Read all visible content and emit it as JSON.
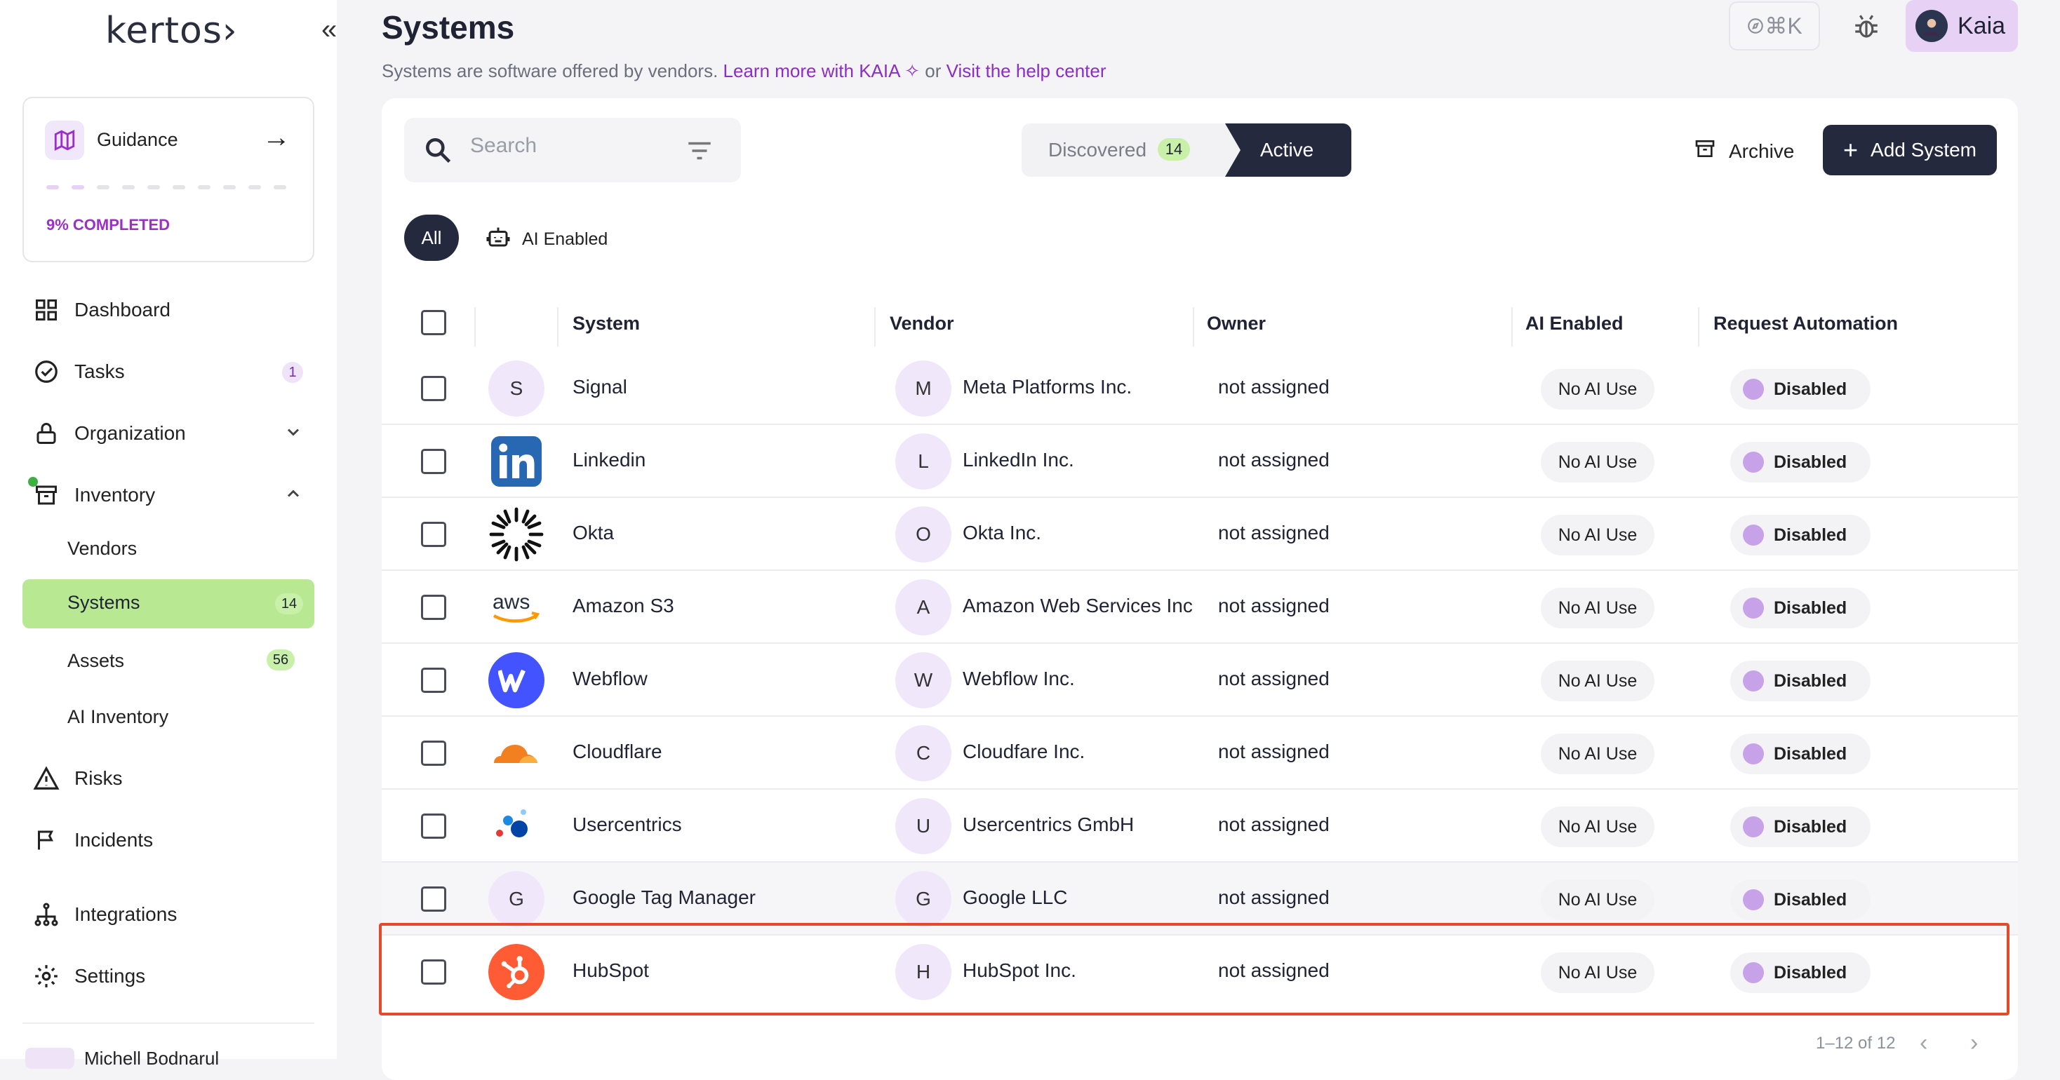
{
  "sidebar": {
    "logo": "kertos›",
    "collapse_icon": "«",
    "guidance": {
      "label": "Guidance",
      "progress_text": "9% COMPLETED",
      "progress": 0.09
    },
    "nav": {
      "dashboard": "Dashboard",
      "tasks": "Tasks",
      "tasks_count": "1",
      "organization": "Organization",
      "inventory": "Inventory",
      "vendors": "Vendors",
      "systems": "Systems",
      "systems_count": "14",
      "assets": "Assets",
      "assets_count": "56",
      "ai_inventory": "AI Inventory",
      "risks": "Risks",
      "incidents": "Incidents",
      "integrations": "Integrations",
      "settings": "Settings"
    },
    "user_bottom": "Michell Bodnarul"
  },
  "header": {
    "title": "Systems",
    "subtitle_prefix": "Systems are software offered by vendors.",
    "link_kaia": "Learn more with KAIA",
    "subtitle_or": "or",
    "link_help": "Visit the help center",
    "shortcut": "⌘K",
    "user_name": "Kaia"
  },
  "toolbar": {
    "search_placeholder": "Search",
    "tab_discovered": "Discovered",
    "tab_discovered_count": "14",
    "tab_active": "Active",
    "archive": "Archive",
    "add_system": "Add System",
    "filter_all": "All",
    "filter_ai": "AI Enabled"
  },
  "table": {
    "columns": {
      "system": "System",
      "vendor": "Vendor",
      "owner": "Owner",
      "ai": "AI Enabled",
      "request": "Request Automation"
    },
    "rows": [
      {
        "system": "Signal",
        "logo": "S",
        "vendor_initial": "M",
        "vendor": "Meta Platforms Inc.",
        "owner": "not assigned",
        "ai": "No AI Use",
        "request": "Disabled"
      },
      {
        "system": "Linkedin",
        "logo": "linkedin-logo",
        "vendor_initial": "L",
        "vendor": "LinkedIn Inc.",
        "owner": "not assigned",
        "ai": "No AI Use",
        "request": "Disabled"
      },
      {
        "system": "Okta",
        "logo": "okta-logo",
        "vendor_initial": "O",
        "vendor": "Okta Inc.",
        "owner": "not assigned",
        "ai": "No AI Use",
        "request": "Disabled"
      },
      {
        "system": "Amazon S3",
        "logo": "aws-logo",
        "vendor_initial": "A",
        "vendor": "Amazon Web Services Inc",
        "owner": "not assigned",
        "ai": "No AI Use",
        "request": "Disabled"
      },
      {
        "system": "Webflow",
        "logo": "webflow-logo",
        "vendor_initial": "W",
        "vendor": "Webflow Inc.",
        "owner": "not assigned",
        "ai": "No AI Use",
        "request": "Disabled"
      },
      {
        "system": "Cloudflare",
        "logo": "cloudflare-logo",
        "vendor_initial": "C",
        "vendor": "Cloudfare Inc.",
        "owner": "not assigned",
        "ai": "No AI Use",
        "request": "Disabled"
      },
      {
        "system": "Usercentrics",
        "logo": "usercentrics-logo",
        "vendor_initial": "U",
        "vendor": "Usercentrics GmbH",
        "owner": "not assigned",
        "ai": "No AI Use",
        "request": "Disabled"
      },
      {
        "system": "Google Tag Manager",
        "logo": "G",
        "vendor_initial": "G",
        "vendor": "Google LLC",
        "owner": "not assigned",
        "ai": "No AI Use",
        "request": "Disabled"
      },
      {
        "system": "HubSpot",
        "logo": "hubspot-logo",
        "vendor_initial": "H",
        "vendor": "HubSpot Inc.",
        "owner": "not assigned",
        "ai": "No AI Use",
        "request": "Disabled"
      }
    ],
    "pagination": "1–12 of 12"
  },
  "colors": {
    "accent": "#8a2ec4",
    "dark": "#24293d",
    "green": "#b9e893",
    "highlight": "#e5492b"
  }
}
